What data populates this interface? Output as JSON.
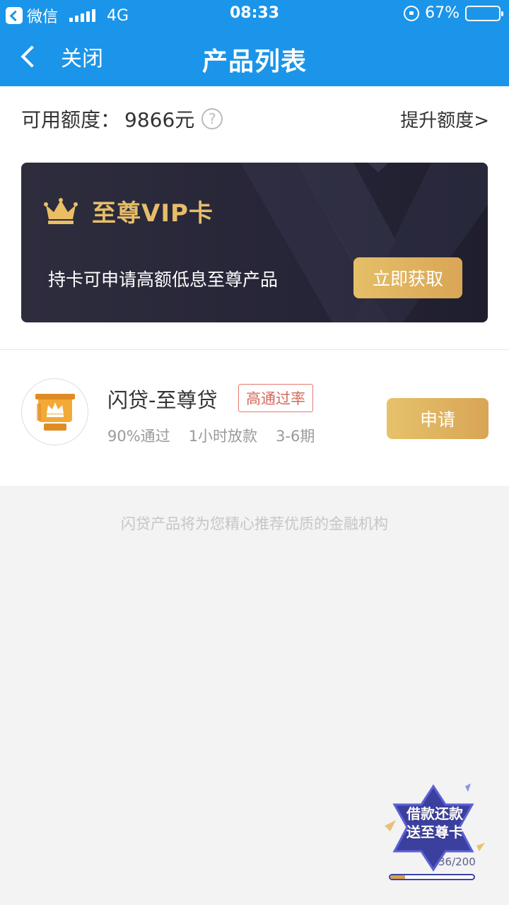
{
  "status_bar": {
    "app": "微信",
    "network": "4G",
    "time": "08:33",
    "battery": "67%",
    "battery_level": 0.67
  },
  "nav": {
    "back_label": "关闭",
    "title": "产品列表"
  },
  "credit": {
    "label": "可用额度：",
    "amount": "9866元",
    "help": "?",
    "raise_link": "提升额度>"
  },
  "vip": {
    "title": "至尊VIP卡",
    "desc": "持卡可申请高额低息至尊产品",
    "button": "立即获取"
  },
  "product": {
    "name": "闪贷-至尊贷",
    "tag": "高通过率",
    "meta": [
      "90%通过",
      "1小时放款",
      "3-6期"
    ],
    "button": "申请"
  },
  "footer_note": "闪贷产品将为您精心推荐优质的金融机构",
  "promo": {
    "line1": "借款还款",
    "line2": "送至尊卡",
    "count": "36/200",
    "progress": 0.18
  },
  "colors": {
    "primary": "#1b95e9",
    "gold": "#e5bf68",
    "card_dark": "#262537"
  }
}
